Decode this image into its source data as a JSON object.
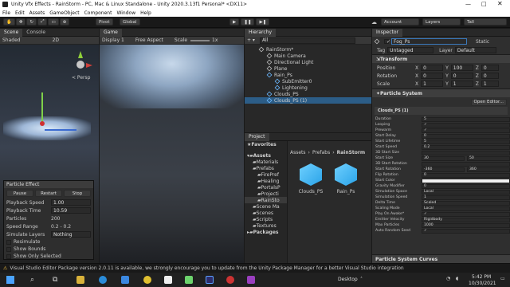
{
  "window": {
    "title": "Unity Vfx Effects - RainStorm - PC, Mac & Linux Standalone - Unity 2020.3.13f1 Personal* <DX11>"
  },
  "menu": [
    "File",
    "Edit",
    "Assets",
    "GameObject",
    "Component",
    "Window",
    "Help"
  ],
  "toolbar": {
    "pivot": "Pivot",
    "space": "Global",
    "account": "Account",
    "layers": "Layers",
    "layout": "Tall"
  },
  "scene": {
    "tabs": [
      "Scene",
      "Console"
    ],
    "shading": "Shaded",
    "mode": "2D",
    "persp": "< Persp"
  },
  "game": {
    "tab": "Game",
    "display": "Display 1",
    "aspect": "Free Aspect",
    "scale_label": "Scale",
    "scale_value": "1x"
  },
  "particle_effect": {
    "title": "Particle Effect",
    "buttons": [
      "Pause",
      "Restart",
      "Stop"
    ],
    "stats": [
      {
        "label": "Playback Speed",
        "value": "1.00"
      },
      {
        "label": "Playback Time",
        "value": "10.59"
      },
      {
        "label": "Particles",
        "value": "200"
      },
      {
        "label": "Speed Range",
        "value": "0.2 - 0.2"
      },
      {
        "label": "Simulate Layers",
        "value": "Nothing"
      }
    ],
    "checks": [
      "Resimulate",
      "Show Bounds",
      "Show Only Selected"
    ]
  },
  "hierarchy": {
    "tab": "Hierarchy",
    "create": "+ ▾",
    "search": "All",
    "items": [
      {
        "label": "RainStorm*",
        "indent": 0
      },
      {
        "label": "Main Camera",
        "indent": 1
      },
      {
        "label": "Directional Light",
        "indent": 1
      },
      {
        "label": "Plane",
        "indent": 1
      },
      {
        "label": "Rain_Ps",
        "indent": 1
      },
      {
        "label": "SubEmitter0",
        "indent": 2
      },
      {
        "label": "Lightening",
        "indent": 2
      },
      {
        "label": "Clouds_PS",
        "indent": 1
      },
      {
        "label": "Clouds_PS (1)",
        "indent": 1
      }
    ]
  },
  "project": {
    "tab": "Project",
    "favorites": "Favorites",
    "assets_label": "Assets",
    "breadcrumb": [
      "Assets",
      "Prefabs",
      "RainStorm"
    ],
    "tree": [
      "Assets",
      "Materials",
      "Prefabs",
      "FirePref",
      "Healing",
      "PortalsP",
      "Projecti",
      "RainSto",
      "Scene Ma",
      "Scenes",
      "Scripts",
      "Textures",
      "Packages"
    ],
    "files": [
      "Clouds_PS",
      "Rain_Ps"
    ]
  },
  "inspector": {
    "tab": "Inspector",
    "object_name": "Fog_Ps",
    "static": "Static",
    "tag_label": "Tag",
    "tag": "Untagged",
    "layer_label": "Layer",
    "layer": "Default",
    "transform": {
      "title": "Transform",
      "rows": [
        {
          "label": "Position",
          "x": "0",
          "y": "100",
          "z": "0"
        },
        {
          "label": "Rotation",
          "x": "0",
          "y": "0",
          "z": "0"
        },
        {
          "label": "Scale",
          "x": "1",
          "y": "1",
          "z": "1"
        }
      ]
    },
    "ps": {
      "title": "Particle System",
      "open_editor": "Open Editor...",
      "module": "Clouds_PS (1)",
      "props": [
        {
          "l": "Duration",
          "v": "5"
        },
        {
          "l": "Looping",
          "v": "✓"
        },
        {
          "l": "Prewarm",
          "v": "✓"
        },
        {
          "l": "Start Delay",
          "v": "0"
        },
        {
          "l": "Start Lifetime",
          "v": "5"
        },
        {
          "l": "Start Speed",
          "v": "0.2"
        },
        {
          "l": "3D Start Size",
          "v": ""
        },
        {
          "l": "Start Size",
          "v": "30"
        },
        {
          "l": "3D Start Rotation",
          "v": ""
        },
        {
          "l": "Start Rotation",
          "v": "-360"
        },
        {
          "l": "Flip Rotation",
          "v": "0"
        },
        {
          "l": "Start Color",
          "v": ""
        },
        {
          "l": "Gravity Modifier",
          "v": "0"
        },
        {
          "l": "Simulation Space",
          "v": "Local"
        },
        {
          "l": "Simulation Speed",
          "v": "1"
        },
        {
          "l": "Delta Time",
          "v": "Scaled"
        },
        {
          "l": "Scaling Mode",
          "v": "Local"
        },
        {
          "l": "Play On Awake*",
          "v": "✓"
        },
        {
          "l": "Emitter Velocity",
          "v": "Rigidbody"
        },
        {
          "l": "Max Particles",
          "v": "1000"
        },
        {
          "l": "Auto Random Seed",
          "v": "✓"
        }
      ],
      "start_size_max": "50",
      "start_rotation_max": "360",
      "curves": "Particle System Curves"
    }
  },
  "status": "Visual Studio Editor Package version 2.0.11 is available, we strongly encourage you to update from the Unity Package Manager for a better Visual Studio integration",
  "taskbar": {
    "desktop": "Desktop",
    "time": "5:42 PM",
    "date": "10/30/2021"
  }
}
